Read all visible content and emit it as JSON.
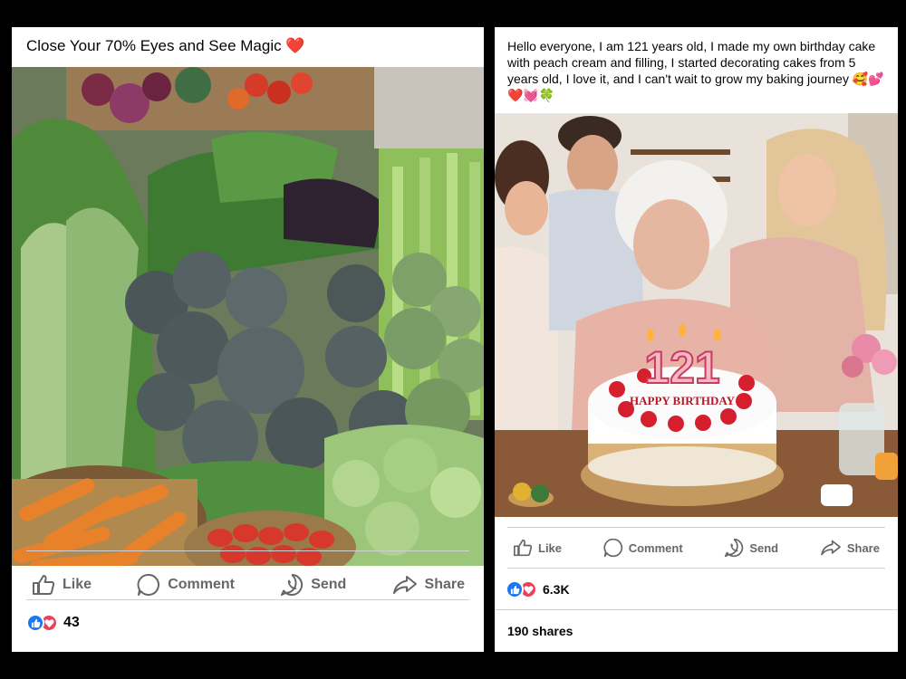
{
  "post_left": {
    "caption": "Close Your 70% Eyes and See Magic ❤️",
    "photo_description": "vegetable market stall photo",
    "actions": {
      "like": "Like",
      "comment": "Comment",
      "send": "Send",
      "share": "Share"
    },
    "reactions": {
      "count": "43",
      "icons": [
        "like-icon",
        "love-icon"
      ]
    }
  },
  "post_right": {
    "caption": "Hello everyone, I am 121 years old, I made my own birthday cake with peach cream and filling, I started decorating cakes from 5 years old, I love it, and I can't wait to grow my baking journey 🥰💕❤️💓🍀",
    "photo_description": "elderly woman with birthday cake photo",
    "cake_candles": "121",
    "cake_text": "HAPPY BIRTHDAY",
    "actions": {
      "like": "Like",
      "comment": "Comment",
      "send": "Send",
      "share": "Share"
    },
    "reactions": {
      "count": "6.3K",
      "icons": [
        "like-icon",
        "love-icon"
      ]
    },
    "shares": "190 shares"
  },
  "colors": {
    "background": "#000000",
    "card": "#ffffff",
    "text": "#050505",
    "muted": "#65676b",
    "like_blue": "#1877f2",
    "love_red": "#f33e58"
  }
}
